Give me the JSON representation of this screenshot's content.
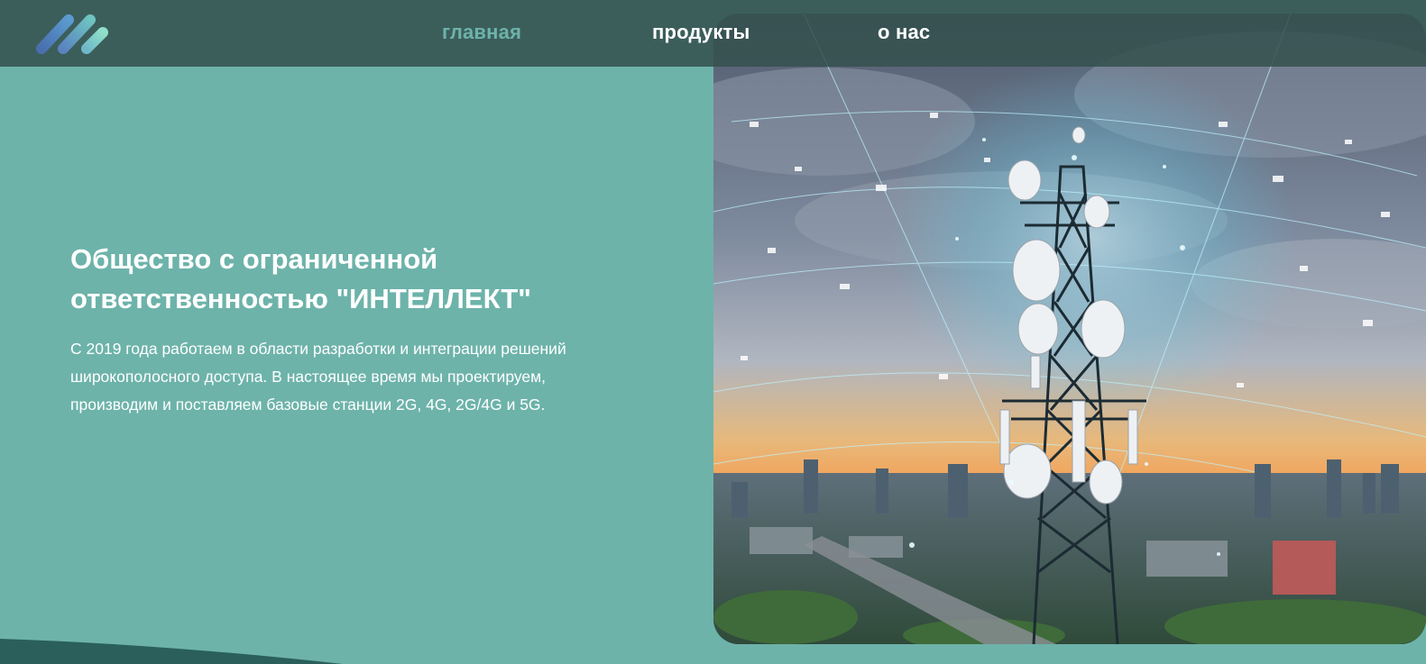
{
  "nav": {
    "items": [
      {
        "label": "главная",
        "active": true
      },
      {
        "label": "продукты",
        "active": false
      },
      {
        "label": "о нас",
        "active": false
      }
    ]
  },
  "hero": {
    "title": "Общество с ограниченной ответственностью \"ИНТЕЛЛЕКТ\"",
    "description": "С 2019 года работаем в области разработки и интеграции решений широкополосного доступа. В настоящее время мы проектируем, производим и поставляем базовые станции 2G, 4G, 2G/4G и 5G."
  },
  "colors": {
    "page_background": "#6db3aa",
    "navbar": "#34504e",
    "nav_active": "#6db3aa",
    "text": "#ffffff",
    "accent_dark": "#2a5f5c"
  },
  "icons": {
    "logo": "logo-stripes-icon"
  }
}
